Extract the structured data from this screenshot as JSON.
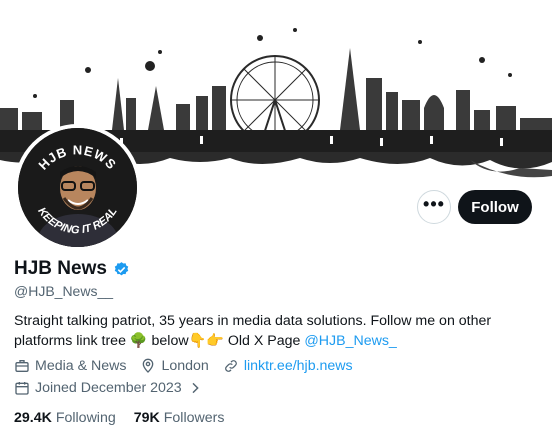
{
  "profile": {
    "name": "HJB News",
    "handle": "@HJB_News__",
    "avatar_ring_top": "HJB NEWS",
    "avatar_ring_bottom": "KEEPING IT REAL",
    "bio_text": "Straight talking patriot, 35 years in media data solutions. Follow me on other platforms link tree 🌳 below👇👉 Old X Page ",
    "bio_mention": "@HJB_News_",
    "category": "Media & News",
    "location": "London",
    "website": "linktr.ee/hjb.news",
    "joined": "Joined December 2023",
    "following_count": "29.4K",
    "following_label": "Following",
    "followers_count": "79K",
    "followers_label": "Followers"
  },
  "actions": {
    "more_label": "•••",
    "follow_label": "Follow"
  },
  "colors": {
    "accent": "#1d9bf0",
    "follow_bg": "#0f1419",
    "secondary_text": "#536471"
  },
  "icons": {
    "verified": "verified-badge-icon",
    "category": "briefcase-icon",
    "location": "location-pin-icon",
    "website": "link-icon",
    "joined": "calendar-icon",
    "more": "more-dots-icon"
  }
}
